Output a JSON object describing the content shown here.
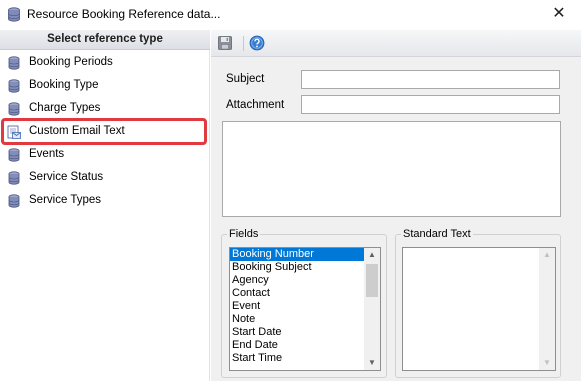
{
  "window": {
    "title": "Resource Booking Reference data...",
    "icon": "database-icon",
    "close_glyph": "✕"
  },
  "left_panel": {
    "header": "Select reference type",
    "items": [
      {
        "label": "Booking Periods",
        "icon": "database-icon"
      },
      {
        "label": "Booking Type",
        "icon": "database-icon"
      },
      {
        "label": "Charge Types",
        "icon": "database-icon"
      },
      {
        "label": "Custom Email Text",
        "icon": "email-template-icon",
        "highlighted": true
      },
      {
        "label": "Events",
        "icon": "database-icon"
      },
      {
        "label": "Service Status",
        "icon": "database-icon"
      },
      {
        "label": "Service Types",
        "icon": "database-icon"
      }
    ]
  },
  "toolbar": {
    "save_icon": "save-icon",
    "help_icon": "help-icon"
  },
  "form": {
    "subject_label": "Subject",
    "subject_value": "",
    "attachment_label": "Attachment",
    "attachment_value": "",
    "body_value": ""
  },
  "fields_group": {
    "title": "Fields",
    "selected_index": 0,
    "items": [
      "Booking Number",
      "Booking Subject",
      "Agency",
      "Contact",
      "Event",
      "Note",
      "Start Date",
      "End Date",
      "Start Time"
    ]
  },
  "standard_text_group": {
    "title": "Standard Text",
    "items": []
  },
  "colors": {
    "highlight_border": "#e0393f",
    "selection": "#0078d7"
  }
}
